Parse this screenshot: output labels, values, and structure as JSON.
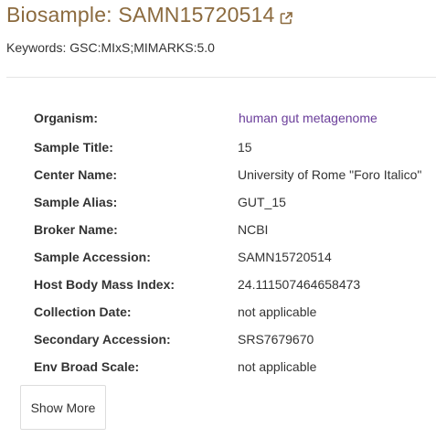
{
  "header": {
    "title": "Biosample: SAMN15720514",
    "keywords": "Keywords: GSC:MIxS;MIMARKS:5.0",
    "external_link_icon": "external-link-icon",
    "title_color": "#8b6a3e"
  },
  "attributes": [
    {
      "label": "Organism:",
      "value": "human gut metagenome"
    },
    {
      "label": "Sample Title:",
      "value": "15"
    },
    {
      "label": "Center Name:",
      "value": "University of Rome \"Foro Italico\""
    },
    {
      "label": "Sample Alias:",
      "value": "GUT_15"
    },
    {
      "label": "Broker Name:",
      "value": "NCBI"
    },
    {
      "label": "Sample Accession:",
      "value": "SAMN15720514"
    },
    {
      "label": "Host Body Mass Index:",
      "value": "24.111507464658473"
    },
    {
      "label": "Collection Date:",
      "value": "not applicable"
    },
    {
      "label": "Secondary Accession:",
      "value": "SRS7679670"
    },
    {
      "label": "Env Broad Scale:",
      "value": "not applicable"
    }
  ],
  "actions": {
    "show_more_label": "Show More"
  },
  "colors": {
    "link": "#6a3d9a"
  }
}
